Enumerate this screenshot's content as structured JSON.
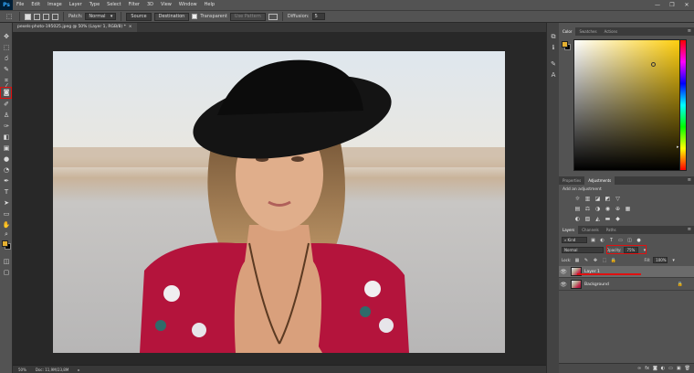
{
  "app": {
    "logo_text": "Ps",
    "window_controls": [
      "—",
      "❐",
      "✕"
    ]
  },
  "menu": [
    "File",
    "Edit",
    "Image",
    "Layer",
    "Type",
    "Select",
    "Filter",
    "3D",
    "View",
    "Window",
    "Help"
  ],
  "options_bar": {
    "patch_label": "Patch:",
    "patch_value": "Normal",
    "source_label": "Source",
    "destination_label": "Destination",
    "transparent_label": "Transparent",
    "use_pattern_label": "Use Pattern",
    "diffusion_label": "Diffusion:",
    "diffusion_value": "5"
  },
  "document": {
    "tab_title": "pexels-photo-195025.jpeg @ 50% (Layer 1, RGB/8) *",
    "zoom": "50%",
    "doc_size": "Doc: 11,9M/23,8M"
  },
  "color_panel": {
    "tabs": [
      "Color",
      "Swatches",
      "Actions"
    ],
    "active_tab": "Color",
    "foreground": "#e5b031",
    "background": "#000000"
  },
  "adjustments_panel": {
    "tabs": [
      "Properties",
      "Adjustments"
    ],
    "active_tab": "Adjustments",
    "title": "Add an adjustment"
  },
  "layers_panel": {
    "tabs": [
      "Layers",
      "Channels",
      "Paths"
    ],
    "active_tab": "Layers",
    "filter_value": "Kind",
    "blend_mode": "Normal",
    "opacity_label": "Opacity:",
    "opacity_value": "75%",
    "lock_label": "Lock:",
    "fill_label": "Fill:",
    "fill_value": "100%",
    "layers": [
      {
        "name": "Layer 1",
        "selected": true,
        "locked": false
      },
      {
        "name": "Background",
        "selected": false,
        "locked": true
      }
    ]
  },
  "accent": {
    "highlight": "#e01010"
  }
}
